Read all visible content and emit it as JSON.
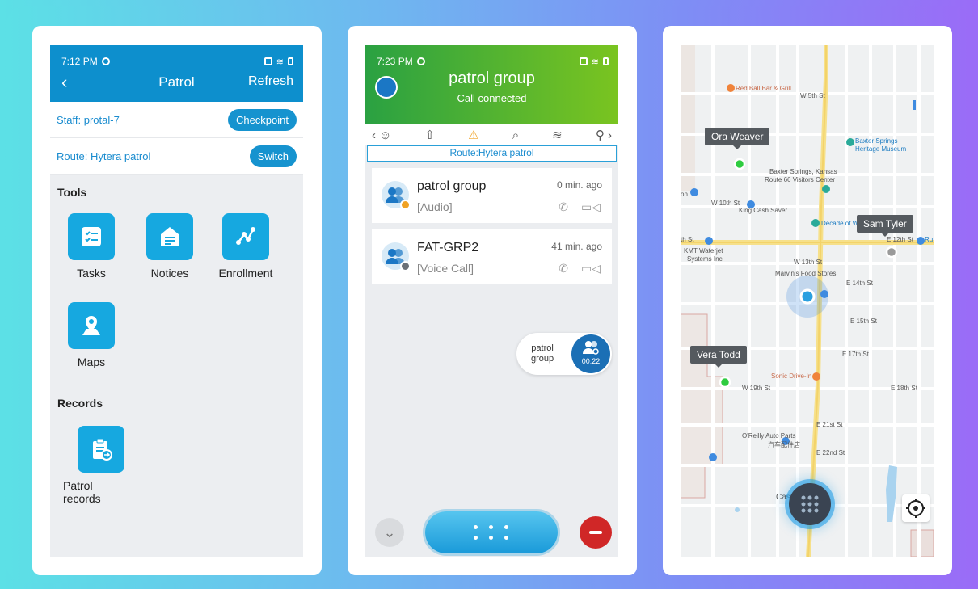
{
  "patrol_screen": {
    "status_time": "7:12 PM",
    "title": "Patrol",
    "refresh": "Refresh",
    "staff_label": "Staff:",
    "staff_value": "protal-7",
    "checkpoint_btn": "Checkpoint",
    "route_label": "Route:",
    "route_value": "Hytera patrol",
    "switch_btn": "Switch",
    "tools_heading": "Tools",
    "tools": [
      {
        "label": "Tasks",
        "icon": "tasks-icon"
      },
      {
        "label": "Notices",
        "icon": "notices-icon"
      },
      {
        "label": "Enrollment",
        "icon": "enrollment-icon"
      },
      {
        "label": "Maps",
        "icon": "maps-icon"
      }
    ],
    "records_heading": "Records",
    "records": [
      {
        "label": "Patrol records",
        "icon": "patrol-records-icon"
      }
    ],
    "colors": {
      "header": "#0d8fcd",
      "tile": "#16a8e0"
    }
  },
  "call_screen": {
    "status_time": "7:23 PM",
    "title": "patrol group",
    "subtitle": "Call connected",
    "route_bar": "Route:Hytera patrol",
    "conversations": [
      {
        "name": "patrol group",
        "type": "[Audio]",
        "time": "0 min. ago",
        "badge_color": "#f0a224"
      },
      {
        "name": "FAT-GRP2",
        "type": "[Voice Call]",
        "time": "41 min. ago",
        "badge_color": "#6b7177"
      }
    ],
    "floating_call": {
      "label_line1": "patrol",
      "label_line2": "group",
      "timer": "00:22"
    },
    "colors": {
      "header_start": "#2aa142",
      "header_end": "#7ac420",
      "hangup": "#d02727"
    }
  },
  "map_screen": {
    "markers": [
      {
        "name": "Ora Weaver",
        "status": "online",
        "color": "#2ecc40"
      },
      {
        "name": "Sam Tyler",
        "status": "offline",
        "color": "#9a9a9a"
      },
      {
        "name": "Vera Todd",
        "status": "online",
        "color": "#2ecc40"
      }
    ],
    "places": {
      "red_ball": "Red Ball Bar & Grill",
      "heritage_1": "Baxter Springs",
      "heritage_2": "Heritage Museum",
      "route66_1": "Baxter Springs, Kansas",
      "route66_2": "Route 66 Visitors Center",
      "king_cash": "King Cash Saver",
      "decade": "Decade of W",
      "kmt_1": "KMT Waterjet",
      "kmt_2": "Systems Inc",
      "marvins": "Marvin's Food Stores",
      "sonic": "Sonic Drive-In",
      "oreilly_1": "O'Reilly Auto Parts",
      "oreilly_2": "汽车配件店",
      "street_12th": "E 12th St",
      "street_5th": "W 5th St",
      "street_19th": "W 19th St",
      "street_22nd": "E 22nd St",
      "street_18th": "E 18th St",
      "street_15th": "E 15th St",
      "street_17th": "E 17th St",
      "street_21st": "E 21st St",
      "street_14th": "E 14th St",
      "street_13th": "W 13th St",
      "street_10th": "W 10th St",
      "frag_th": "th St",
      "frag_on": "on",
      "frag_ru": "Ru",
      "frag_cas": "Cas"
    }
  }
}
